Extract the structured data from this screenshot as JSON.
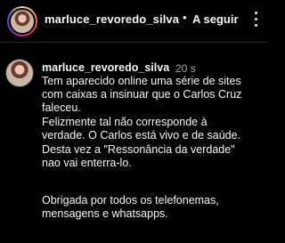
{
  "header": {
    "username": "marluce_revoredo_silva",
    "separator": "•",
    "follow_label": "A seguir",
    "more_icon": "more-horizontal-icon"
  },
  "post": {
    "username": "marluce_revoredo_silva",
    "time": "20 s",
    "caption_lines": [
      "Tem aparecido online uma série de sites",
      "com caixas a insinuar que o Carlos Cruz",
      "faleceu.",
      "Felizmente tal não corresponde à",
      "verdade. O Carlos está vivo e de saúde.",
      "Desta vez a \"Ressonância da verdade\"",
      "nao vai enterra-lo.",
      "",
      "Obrigada por todos os telefonemas,",
      "mensagens e whatsapps."
    ]
  },
  "colors": {
    "background": "#000000",
    "text": "#f5f5f5",
    "secondary_text": "#a8a8a8",
    "divider": "#262626"
  }
}
